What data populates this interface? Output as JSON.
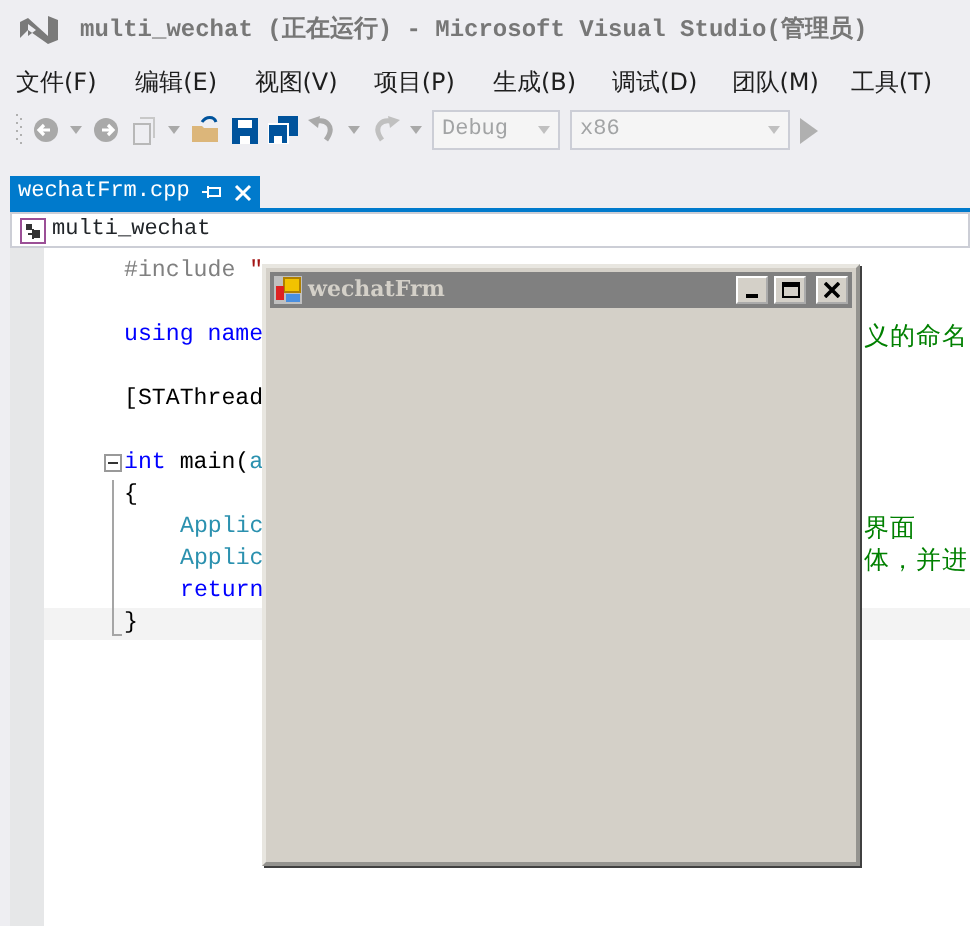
{
  "window": {
    "title": "multi_wechat (正在运行) - Microsoft Visual Studio(管理员)"
  },
  "menu": [
    "文件(F)",
    "编辑(E)",
    "视图(V)",
    "项目(P)",
    "生成(B)",
    "调试(D)",
    "团队(M)",
    "工具(T)"
  ],
  "toolbar": {
    "dropdowns": [
      {
        "value": "Debug",
        "disabled": true
      },
      {
        "value": "x86",
        "disabled": true
      }
    ]
  },
  "tabs": [
    {
      "label": "wechatFrm.cpp",
      "selected": true
    }
  ],
  "navigation": {
    "scope": "multi_wechat"
  },
  "code_lines": [
    {
      "kind": "plain",
      "parts": [
        {
          "text": "#include ",
          "kind": "directive"
        },
        {
          "text": "\"",
          "kind": "string"
        }
      ]
    },
    {
      "kind": "blank"
    },
    {
      "kind": "plain",
      "parts": [
        {
          "text": "using name",
          "kind": "keyword"
        }
      ],
      "right": "义的命名"
    },
    {
      "kind": "blank"
    },
    {
      "kind": "plain",
      "parts": [
        {
          "text": "[STAThread",
          "kind": "plain"
        }
      ]
    },
    {
      "kind": "blank"
    },
    {
      "kind": "region_start",
      "parts": [
        {
          "text": "int",
          "kind": "keyword"
        },
        {
          "text": " main(",
          "kind": "plain"
        },
        {
          "text": "a",
          "kind": "type"
        }
      ]
    },
    {
      "kind": "region_body",
      "parts": [
        {
          "text": "{",
          "kind": "plain"
        }
      ]
    },
    {
      "kind": "region_body",
      "indent": true,
      "parts": [
        {
          "text": "Applic",
          "kind": "type"
        }
      ],
      "right": "界面"
    },
    {
      "kind": "region_body",
      "indent": true,
      "parts": [
        {
          "text": "Applic",
          "kind": "type"
        }
      ],
      "right": "体，并进"
    },
    {
      "kind": "region_body",
      "indent": true,
      "parts": [
        {
          "text": "return",
          "kind": "keyword"
        }
      ]
    },
    {
      "kind": "region_end",
      "current": true,
      "parts": [
        {
          "text": "}",
          "kind": "plain"
        }
      ]
    }
  ],
  "form_window": {
    "title": "wechatFrm",
    "active": false
  }
}
